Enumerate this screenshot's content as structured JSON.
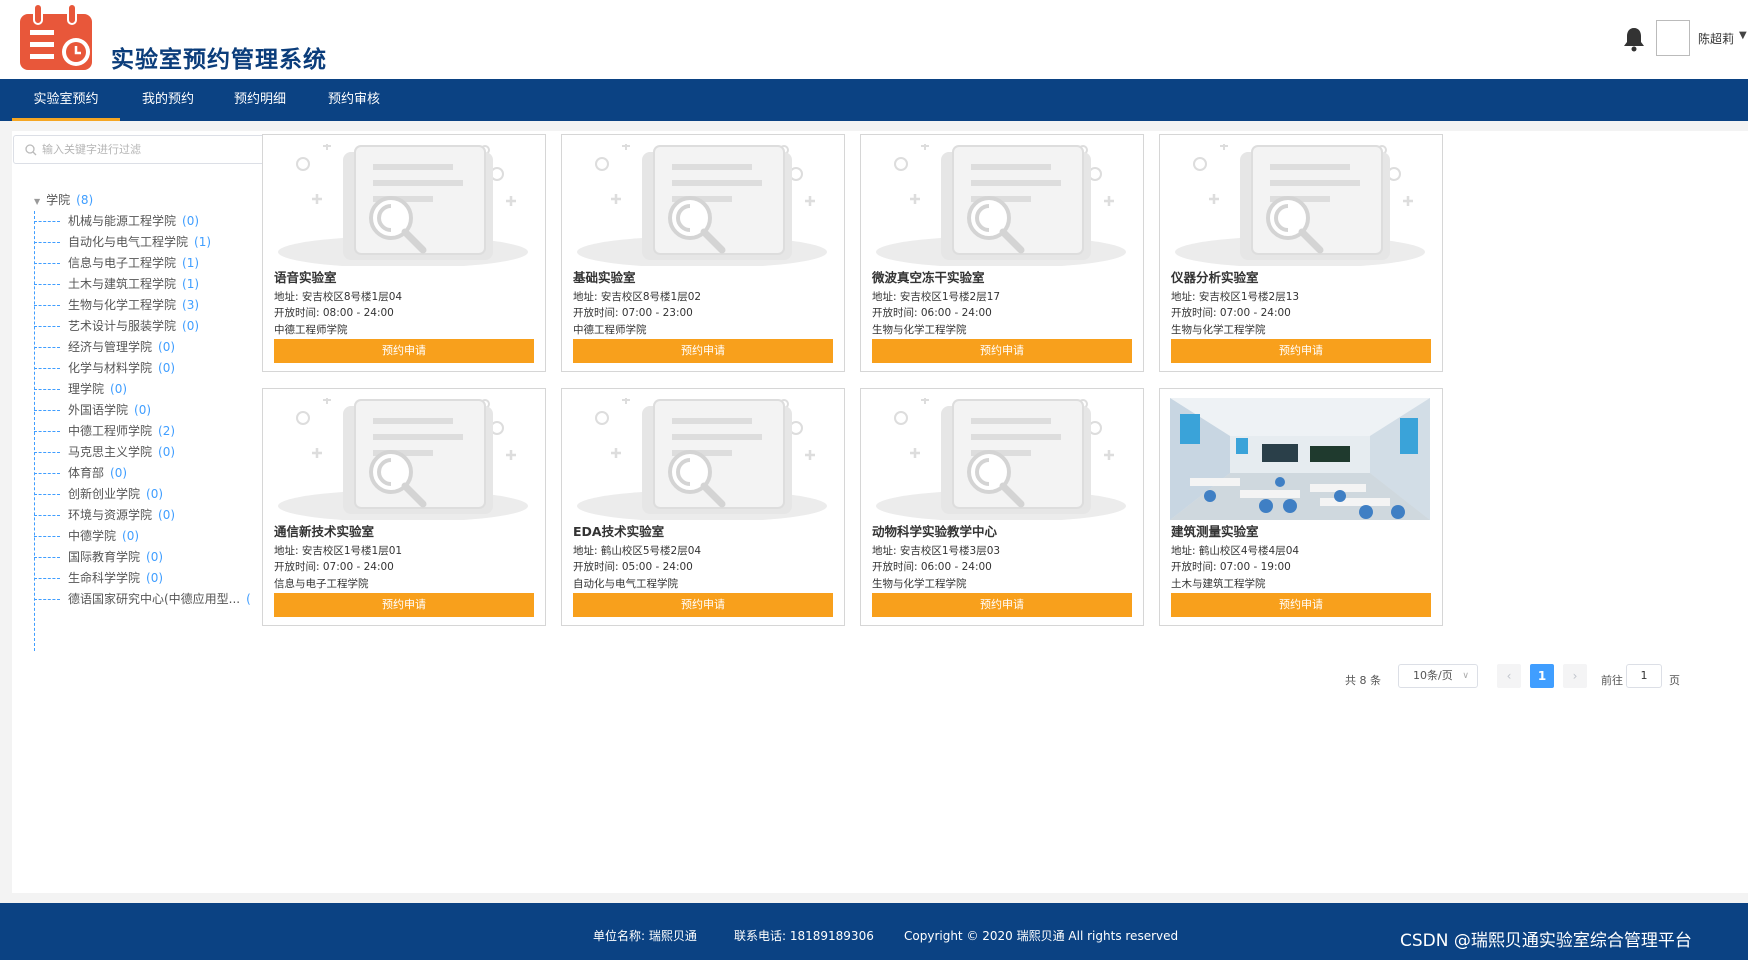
{
  "header": {
    "title": "实验室预约管理系统",
    "user_name": "陈超莉",
    "accent_color": "#e8573a"
  },
  "nav": {
    "items": [
      "实验室预约",
      "我的预约",
      "预约明细",
      "预约审核"
    ],
    "active": "实验室预约"
  },
  "sidebar": {
    "search_placeholder": "输入关键字进行过滤",
    "root": {
      "label": "学院",
      "count": "(8)"
    },
    "items": [
      {
        "label": "机械与能源工程学院",
        "count": "(0)"
      },
      {
        "label": "自动化与电气工程学院",
        "count": "(1)"
      },
      {
        "label": "信息与电子工程学院",
        "count": "(1)"
      },
      {
        "label": "土木与建筑工程学院",
        "count": "(1)"
      },
      {
        "label": "生物与化学工程学院",
        "count": "(3)"
      },
      {
        "label": "艺术设计与服装学院",
        "count": "(0)"
      },
      {
        "label": "经济与管理学院",
        "count": "(0)"
      },
      {
        "label": "化学与材料学院",
        "count": "(0)"
      },
      {
        "label": "理学院",
        "count": "(0)"
      },
      {
        "label": "外国语学院",
        "count": "(0)"
      },
      {
        "label": "中德工程师学院",
        "count": "(2)"
      },
      {
        "label": "马克思主义学院",
        "count": "(0)"
      },
      {
        "label": "体育部",
        "count": "(0)"
      },
      {
        "label": "创新创业学院",
        "count": "(0)"
      },
      {
        "label": "环境与资源学院",
        "count": "(0)"
      },
      {
        "label": "中德学院",
        "count": "(0)"
      },
      {
        "label": "国际教育学院",
        "count": "(0)"
      },
      {
        "label": "生命科学学院",
        "count": "(0)"
      },
      {
        "label": "德语国家研究中心(中德应用型...",
        "count": "("
      }
    ]
  },
  "labs": [
    {
      "name": "语音实验室",
      "address": "地址: 安吉校区8号楼1层04",
      "hours": "开放时间: 08:00 - 24:00",
      "college": "中德工程师学院",
      "button": "预约申请",
      "image": "placeholder-icon"
    },
    {
      "name": "基础实验室",
      "address": "地址: 安吉校区8号楼1层02",
      "hours": "开放时间: 07:00 - 23:00",
      "college": "中德工程师学院",
      "button": "预约申请",
      "image": "placeholder-icon"
    },
    {
      "name": "微波真空冻干实验室",
      "address": "地址: 安吉校区1号楼2层17",
      "hours": "开放时间: 06:00 - 24:00",
      "college": "生物与化学工程学院",
      "button": "预约申请",
      "image": "placeholder-icon"
    },
    {
      "name": "仪器分析实验室",
      "address": "地址: 安吉校区1号楼2层13",
      "hours": "开放时间: 07:00 - 24:00",
      "college": "生物与化学工程学院",
      "button": "预约申请",
      "image": "placeholder-icon"
    },
    {
      "name": "通信新技术实验室",
      "address": "地址: 安吉校区1号楼1层01",
      "hours": "开放时间: 07:00 - 24:00",
      "college": "信息与电子工程学院",
      "button": "预约申请",
      "image": "placeholder-icon"
    },
    {
      "name": "EDA技术实验室",
      "address": "地址: 鹤山校区5号楼2层04",
      "hours": "开放时间: 05:00 - 24:00",
      "college": "自动化与电气工程学院",
      "button": "预约申请",
      "image": "placeholder-icon"
    },
    {
      "name": "动物科学实验教学中心",
      "address": "地址: 安吉校区1号楼3层03",
      "hours": "开放时间: 06:00 - 24:00",
      "college": "生物与化学工程学院",
      "button": "预约申请",
      "image": "placeholder-icon"
    },
    {
      "name": "建筑测量实验室",
      "address": "地址: 鹤山校区4号楼4层04",
      "hours": "开放时间: 07:00 - 19:00",
      "college": "土木与建筑工程学院",
      "button": "预约申请",
      "image": "classroom-photo"
    }
  ],
  "pagination": {
    "total": "共 8 条",
    "page_size": "10条/页",
    "current_page": "1",
    "goto_label": "前往",
    "goto_value": "1",
    "page_suffix": "页"
  },
  "footer": {
    "unit": "单位名称: 瑞熙贝通",
    "phone": "联系电话: 18189189306",
    "copyright": "Copyright © 2020 瑞熙贝通 All rights reserved",
    "watermark": "CSDN @瑞熙贝通实验室综合管理平台"
  }
}
